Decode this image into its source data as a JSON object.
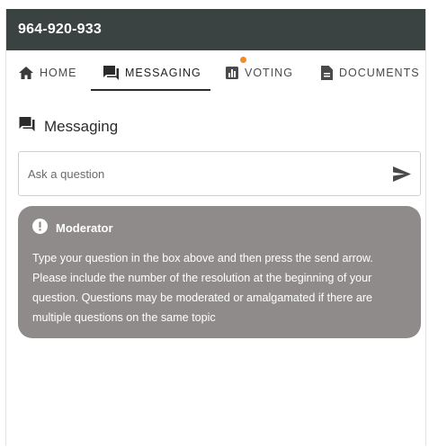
{
  "header": {
    "title": "964-920-933"
  },
  "tabs": [
    {
      "label": "HOME",
      "icon": "home-icon"
    },
    {
      "label": "MESSAGING",
      "icon": "chat-icon",
      "active": true
    },
    {
      "label": "VOTING",
      "icon": "bar-chart-icon",
      "has_notification": true
    },
    {
      "label": "DOCUMENTS",
      "icon": "document-icon"
    }
  ],
  "colors": {
    "topbar": "#3b4342",
    "moderator_bg": "#8f8b8b",
    "notification_dot": "#f28c28"
  },
  "messaging": {
    "title": "Messaging",
    "input": {
      "placeholder": "Ask a question",
      "value": ""
    },
    "send_icon": "send-arrow-icon",
    "moderator": {
      "icon": "alert-circle-icon",
      "title": "Moderator",
      "message": "Type your question in the box above and then press the send arrow. Please include the number of the resolution at the beginning of your question. Questions may be moderated or amalgamated if there are multiple questions on the same topic"
    }
  }
}
